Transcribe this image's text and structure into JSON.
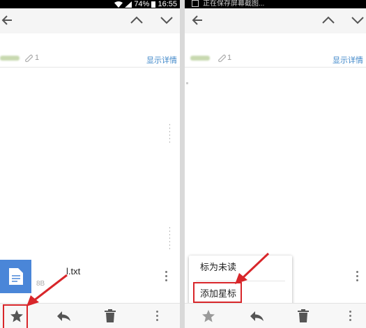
{
  "status_bar": {
    "battery": "74%",
    "time": "16:55"
  },
  "notification": {
    "text": "正在保存屏幕截图..."
  },
  "email": {
    "show_details_label": "显示详情",
    "attachment_count": "1"
  },
  "attachment": {
    "file_name": "l.txt",
    "file_size": "8B"
  },
  "menu": {
    "items": [
      "标为未读",
      "添加星标"
    ]
  },
  "icons": {
    "back": "arrow-left-icon",
    "prev": "chevron-up-icon",
    "next": "chevron-down-icon",
    "star": "star-icon",
    "reply": "reply-icon",
    "delete": "trash-icon",
    "more": "more-vert-icon",
    "file": "document-icon",
    "attach": "paperclip-icon"
  },
  "colors": {
    "highlight": "#d8262a",
    "link": "#3f87c9",
    "file_thumb": "#4a86d8"
  }
}
